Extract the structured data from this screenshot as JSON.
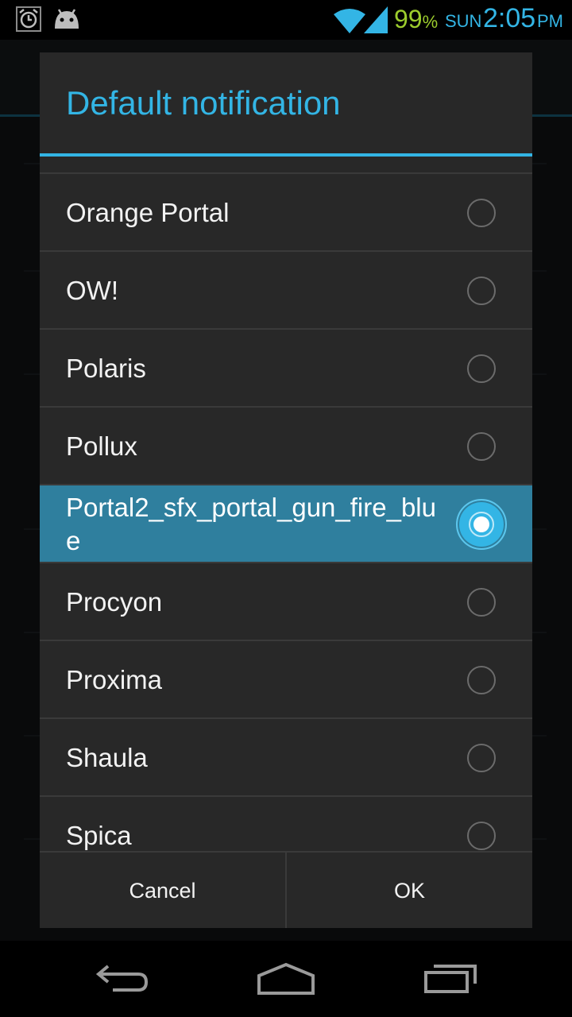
{
  "status_bar": {
    "battery_percent": "99",
    "percent_sign": "%",
    "day": "SUN",
    "time": "2:05",
    "ampm": "PM",
    "battery_color": "#9ccc2d",
    "clock_color": "#33b5e5",
    "icons": [
      "alarm-icon",
      "android-icon",
      "wifi-icon",
      "signal-icon"
    ]
  },
  "dialog": {
    "title": "Default notification",
    "accent_color": "#33b5e5",
    "items": [
      {
        "label": "Orange Portal",
        "selected": false
      },
      {
        "label": "OW!",
        "selected": false
      },
      {
        "label": "Polaris",
        "selected": false
      },
      {
        "label": "Pollux",
        "selected": false
      },
      {
        "label": "Portal2_sfx_portal_gun_fire_blue",
        "selected": true
      },
      {
        "label": "Procyon",
        "selected": false
      },
      {
        "label": "Proxima",
        "selected": false
      },
      {
        "label": "Shaula",
        "selected": false
      },
      {
        "label": "Spica",
        "selected": false
      }
    ],
    "cancel_label": "Cancel",
    "ok_label": "OK"
  },
  "nav_bar": {
    "icons": [
      "back-icon",
      "home-icon",
      "recent-apps-icon"
    ]
  }
}
